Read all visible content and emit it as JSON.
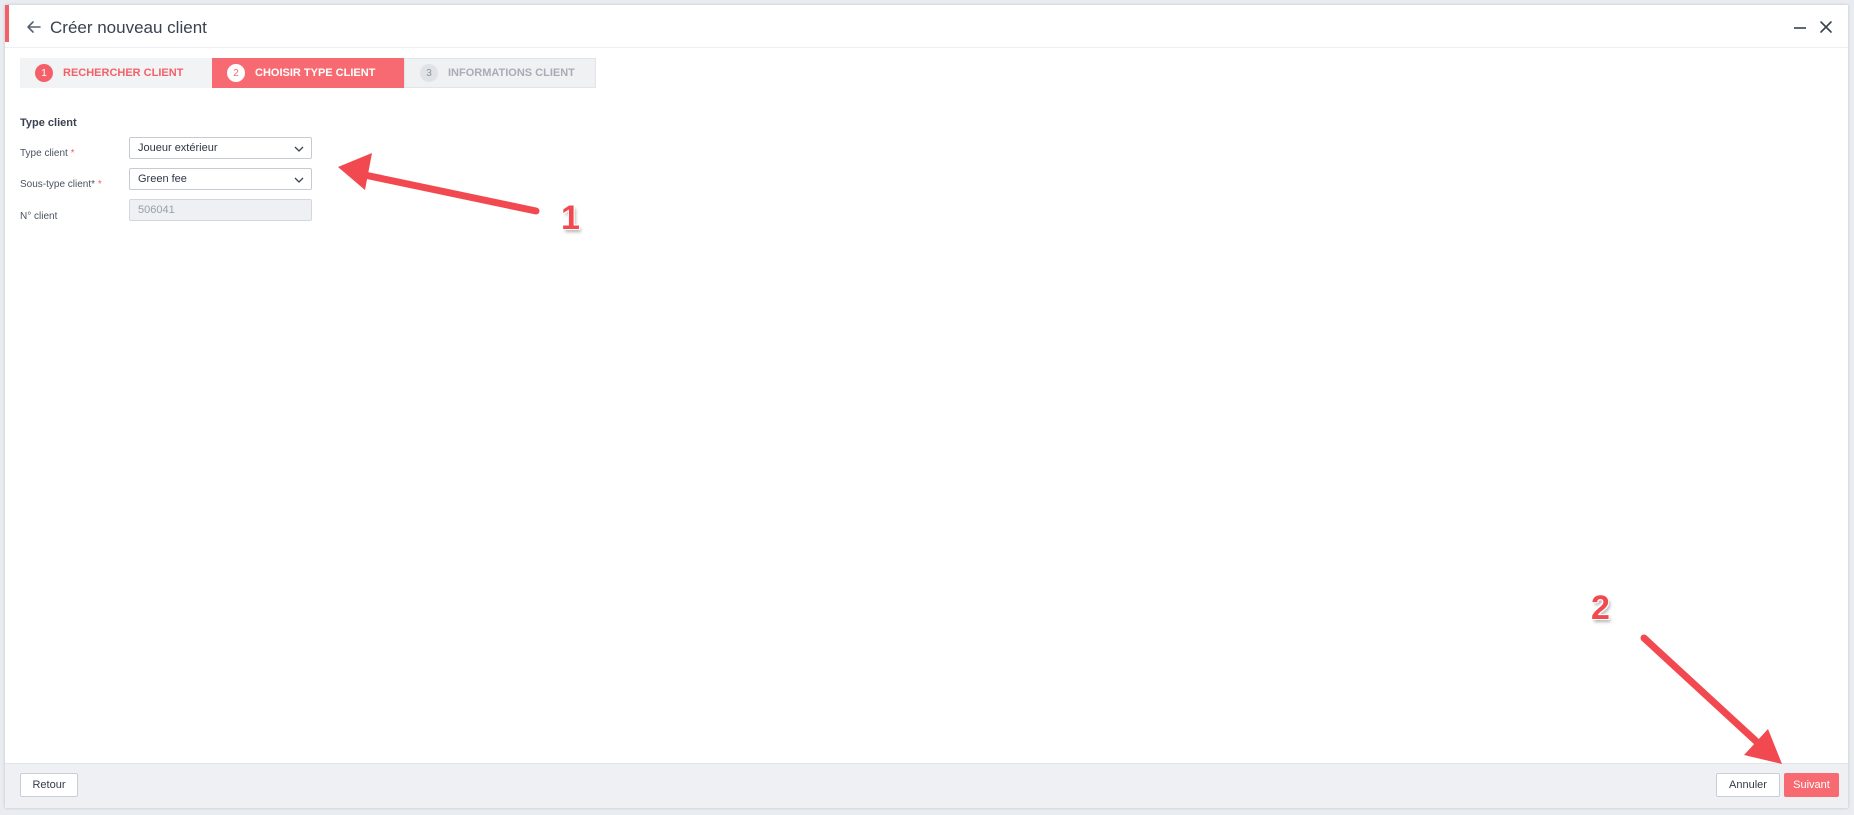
{
  "window": {
    "title": "Créer nouveau client",
    "accent_color": "#f4606a"
  },
  "stepper": {
    "steps": [
      {
        "number": "1",
        "label": "RECHERCHER CLIENT",
        "state": "done"
      },
      {
        "number": "2",
        "label": "CHOISIR TYPE CLIENT",
        "state": "active"
      },
      {
        "number": "3",
        "label": "INFORMATIONS CLIENT",
        "state": "pending"
      }
    ]
  },
  "form": {
    "section_title": "Type client",
    "type_client": {
      "label": "Type client",
      "required_marker": "*",
      "value": "Joueur extérieur"
    },
    "sous_type": {
      "label": "Sous-type client*",
      "required_marker": "*",
      "value": "Green fee"
    },
    "numero": {
      "label": "N° client",
      "value": "506041"
    }
  },
  "footer": {
    "back_label": "Retour",
    "cancel_label": "Annuler",
    "next_label": "Suivant",
    "primary_color": "#f76a72"
  },
  "annotations": {
    "arrow_1_label": "1",
    "arrow_2_label": "2",
    "arrow_color": "#f2484f"
  }
}
